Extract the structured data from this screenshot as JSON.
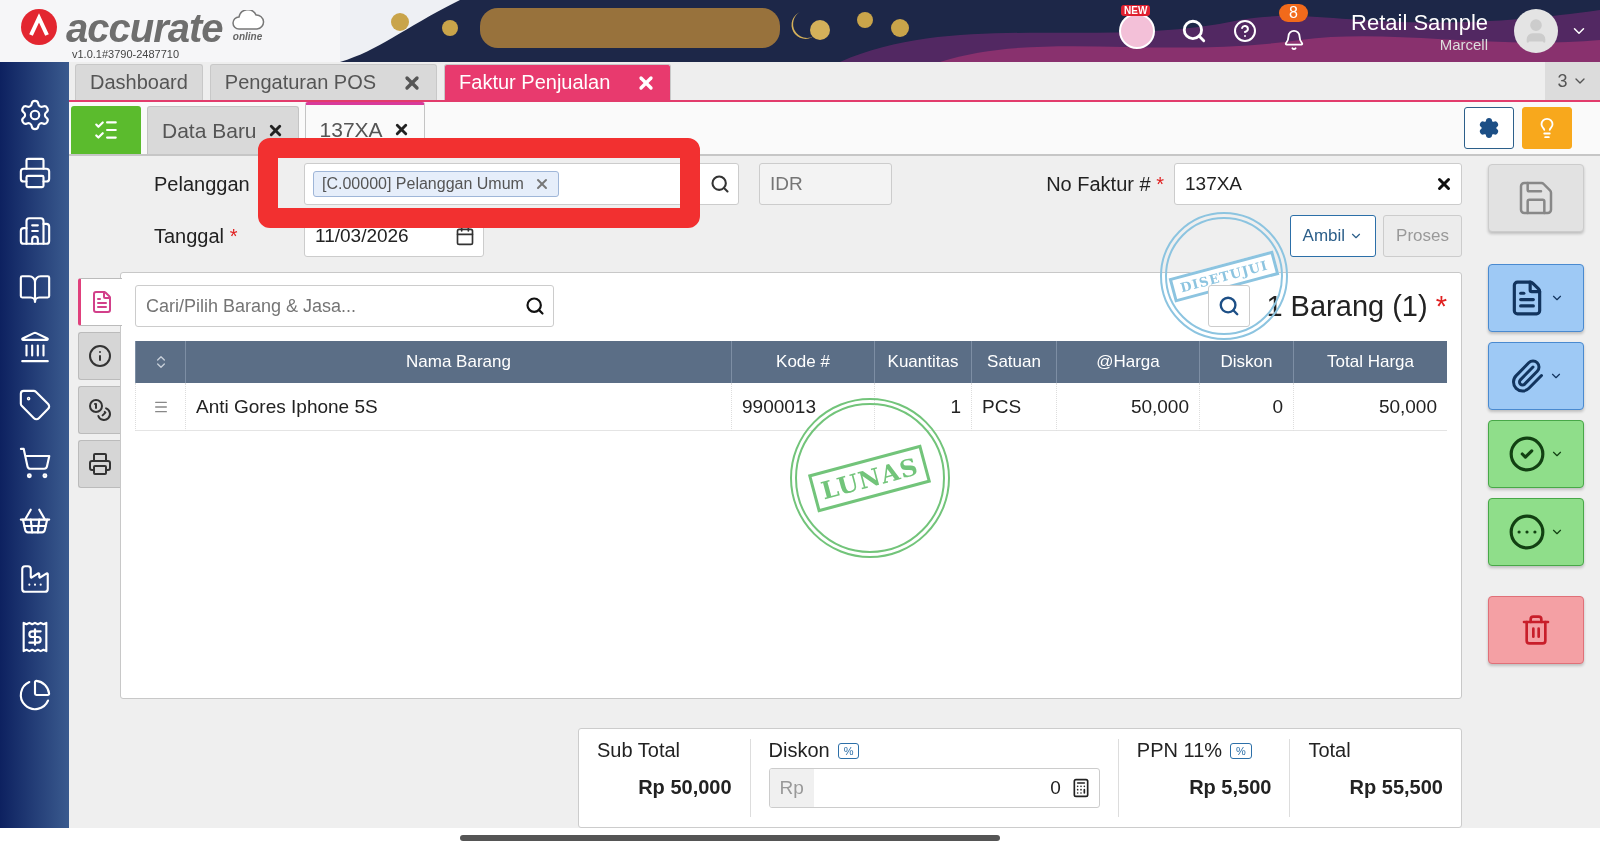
{
  "app": {
    "logo": "accurate",
    "logo_sub": "online",
    "version": "v1.0.1#3790-2487710"
  },
  "header": {
    "new_badge": "NEW",
    "notification_count": "8",
    "company": "Retail Sample",
    "user": "Marcell"
  },
  "tabs": [
    {
      "label": "Dashboard",
      "closable": false,
      "selected": false
    },
    {
      "label": "Pengaturan POS",
      "closable": true,
      "selected": false
    },
    {
      "label": "Faktur Penjualan",
      "closable": true,
      "selected": true
    }
  ],
  "tab_overflow": "3",
  "subtabs": [
    {
      "label": "Data Baru",
      "selected": false
    },
    {
      "label": "137XA",
      "selected": true
    }
  ],
  "form": {
    "customer_label": "Pelanggan",
    "customer_tag": "[C.00000] Pelanggan Umum",
    "currency_placeholder": "IDR",
    "date_label": "Tanggal",
    "date_required": "*",
    "date_value": "11/03/2026",
    "invoice_label": "No Faktur #",
    "invoice_required": "*",
    "invoice_value": "137XA",
    "take_button": "Ambil",
    "process_button": "Proses",
    "process_disabled": true
  },
  "side_tabs": [
    {
      "selected": true
    },
    {
      "selected": false
    },
    {
      "selected": false
    },
    {
      "selected": false
    }
  ],
  "items": {
    "search_placeholder": "Cari/Pilih Barang & Jasa...",
    "count_title": "1 Barang (1)",
    "required": "*",
    "columns": [
      "Nama Barang",
      "Kode #",
      "Kuantitas",
      "Satuan",
      "@Harga",
      "Diskon",
      "Total Harga"
    ],
    "rows": [
      {
        "cells": [
          "Anti Gores Iphone 5S",
          "9900013",
          "1",
          "PCS",
          "50,000",
          "0",
          "50,000"
        ]
      }
    ]
  },
  "stamps": [
    {
      "text": "DISETUJUI",
      "color": "#8cc4e0"
    },
    {
      "text": "LUNAS",
      "color": "#72c47a"
    }
  ],
  "summary": {
    "subtotal_label": "Sub Total",
    "subtotal": "Rp 50,000",
    "discount_label": "Diskon",
    "discount_toggle": "%",
    "discount_prefix": "Rp",
    "discount_value": "0",
    "tax_label": "PPN 11%",
    "tax_toggle": "%",
    "tax": "Rp 5,500",
    "total_label": "Total",
    "total": "Rp 55,500"
  }
}
